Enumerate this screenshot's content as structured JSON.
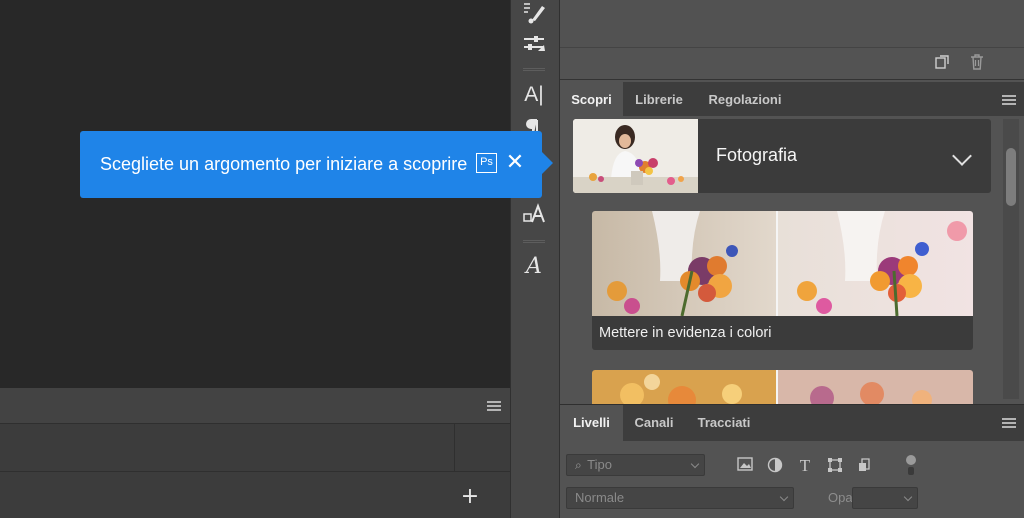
{
  "tooltip": {
    "text": "Scegliete un argomento per iniziare a scoprire",
    "badge": "Ps",
    "close_glyph": "✕"
  },
  "discover_panel": {
    "tabs": [
      {
        "label": "Scopri",
        "active": true
      },
      {
        "label": "Librerie",
        "active": false
      },
      {
        "label": "Regolazioni",
        "active": false
      }
    ],
    "topic": {
      "title": "Fotografia",
      "icon": "chevron-down-icon"
    },
    "lessons": [
      {
        "label": "Mettere in evidenza i colori"
      },
      {
        "label": ""
      }
    ]
  },
  "layers_panel": {
    "tabs": [
      {
        "label": "Livelli",
        "active": true
      },
      {
        "label": "Canali",
        "active": false
      },
      {
        "label": "Tracciati",
        "active": false
      }
    ],
    "filter_placeholder": "Tipo",
    "blend_mode": "Normale",
    "opacity_label": "Opacità:",
    "filter_icons": [
      "image-filter-icon",
      "adjustment-filter-icon",
      "type-filter-icon",
      "shape-filter-icon",
      "smart-object-filter-icon"
    ]
  },
  "left_panel": {
    "add_button": "+"
  },
  "toolstrip": {
    "tools": [
      "brush-settings-icon",
      "adjustments-icon",
      "character-icon",
      "paragraph-icon",
      "character-styles-icon",
      "glyphs-icon"
    ]
  },
  "colors": {
    "accent": "#1f84e8",
    "panel": "#535353",
    "canvas": "#282828"
  }
}
